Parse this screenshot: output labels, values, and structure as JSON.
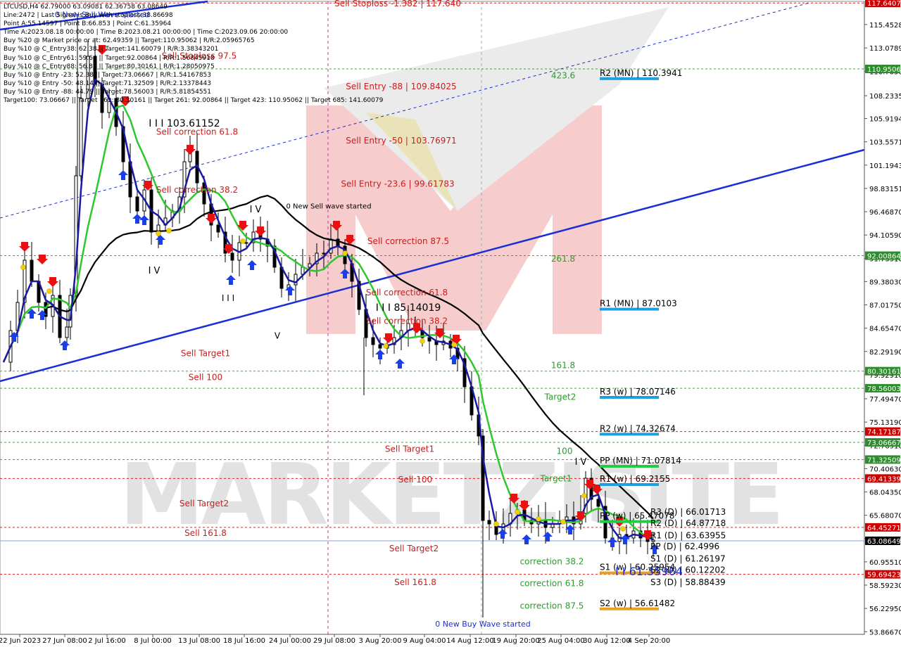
{
  "symbol_header": "LTCUSD,H4  62.79000 63.09081 62.36758 63.08649",
  "info_lines": [
    "Line:2472 | Last Signal is:Buy with stoploss:38.86698",
    "Point A:55.14597 | Point B:66.853 | Point C:61.35964",
    "Time A:2023.08.18 00:00:00 | Time B:2023.08.21 00:00:00 | Time C:2023.09.06 20:00:00",
    "Buy %20 @ Market price or at: 62.49359 || Target:110.95062 | R/R:2.05965765",
    "Buy %10 @ C_Entry38: 62.38 || Target:141.60079 | R/R:3.38343201",
    "Buy %10 @ C_Entry61: 59.64 || Target:92.00864 | R/R:1.56845918",
    "Buy %10 @ C_Entry88: 56.86 || Target:80.30161 | R/R:1.28050975",
    "Buy %10 @ Entry -23: 52.38 || Target:73.06667 | R/R:1.54167853",
    "Buy %10 @ Entry -50: 48.14 || Target:71.32509 | R/R:2.13378443",
    "Buy %10 @ Entry -88: 44.79 || Target:78.56003 | R/R:5.81854551",
    "Target100: 73.06667 || Target 161: 80.30161 || Target 261: 92.00864 || Target 423: 110.95062 || Target 685: 141.60079"
  ],
  "chart_data": {
    "type": "candlestick",
    "y_range": [
      53.6,
      117.8
    ],
    "price_ticks": [
      "115.45280",
      "113.07890",
      "110.70500",
      "108.23350",
      "105.91940",
      "103.55710",
      "101.19430",
      "98.83151",
      "96.46870",
      "94.10590",
      "91.73310",
      "89.38030",
      "87.01750",
      "84.65470",
      "82.29190",
      "79.92910",
      "77.49470",
      "75.13190",
      "72.76910",
      "70.40630",
      "68.04350",
      "65.68070",
      "63.31790",
      "60.95510",
      "58.59230",
      "56.22950",
      "53.86670"
    ],
    "time_labels": [
      "22 Jun 2023",
      "27 Jun 08:00",
      "2 Jul 16:00",
      "8 Jul 00:00",
      "13 Jul 08:00",
      "18 Jul 16:00",
      "24 Jul 00:00",
      "29 Jul 08:00",
      "3 Aug 20:00",
      "9 Aug 04:00",
      "14 Aug 12:00",
      "19 Aug 20:00",
      "25 Aug 04:00",
      "30 Aug 12:00",
      "4 Sep 20:00"
    ],
    "price_boxes": [
      {
        "value": "117.64075",
        "price": 117.64,
        "color": "#cc0000"
      },
      {
        "value": "110.95062",
        "price": 110.95,
        "color": "#2e8b2e"
      },
      {
        "value": "92.00864",
        "price": 92.01,
        "color": "#2e8b2e"
      },
      {
        "value": "80.30161",
        "price": 80.3,
        "color": "#2e8b2e"
      },
      {
        "value": "78.56003",
        "price": 78.56,
        "color": "#2e8b2e"
      },
      {
        "value": "74.17187",
        "price": 74.17,
        "color": "#cc0000"
      },
      {
        "value": "73.06667",
        "price": 73.07,
        "color": "#2e8b2e"
      },
      {
        "value": "71.32509",
        "price": 71.33,
        "color": "#2e8b2e"
      },
      {
        "value": "69.41339",
        "price": 69.41,
        "color": "#cc0000"
      },
      {
        "value": "64.45271",
        "price": 64.45,
        "color": "#cc0000"
      },
      {
        "value": "63.08649",
        "price": 63.09,
        "color": "#000000"
      },
      {
        "value": "59.69423",
        "price": 59.69,
        "color": "#cc0000"
      }
    ],
    "pivots": [
      {
        "label": "R2 (MN) | 110.3941",
        "price": 110.39,
        "color": "#1ea0e0"
      },
      {
        "label": "R1 (MN) | 87.0103",
        "price": 87.01,
        "color": "#1ea0e0"
      },
      {
        "label": "R3 (w) | 78.07146",
        "price": 78.07,
        "color": "#1ea0e0"
      },
      {
        "label": "R2 (w) | 74.32674",
        "price": 74.33,
        "color": "#1ea0e0"
      },
      {
        "label": "PP (MN) | 71.07814",
        "price": 71.08,
        "color": "#22cc44"
      },
      {
        "label": "R1 (w) | 69.2155",
        "price": 69.22,
        "color": "#1ea0e0"
      },
      {
        "label": "PP (w) | 65.47078",
        "price": 65.47,
        "color": "#22cc44"
      },
      {
        "label": "S1 (w) | 60.25954",
        "price": 60.26,
        "color": "#e8a020"
      },
      {
        "label": "S2 (w) | 56.61482",
        "price": 56.61,
        "color": "#e8a020"
      }
    ],
    "daily_pivots": [
      {
        "label": "R3 (D) | 66.01713",
        "price": 66.02
      },
      {
        "label": "R2 (D) | 64.87718",
        "price": 64.88
      },
      {
        "label": "R1 (D) | 63.63955",
        "price": 63.64
      },
      {
        "label": "PP (D) | 62.4996",
        "price": 62.5
      },
      {
        "label": "S1 (D) | 61.26197",
        "price": 61.26
      },
      {
        "label": "S2 (D) | 60.12202",
        "price": 60.12
      },
      {
        "label": "S3 (D) | 58.88439",
        "price": 58.88
      }
    ],
    "red_labels": [
      {
        "text": "Sell Stoploss -1.382 | 117.640",
        "price": 117.3
      },
      {
        "text": "Sell Entry -88 | 109.84025",
        "price": 108.9
      },
      {
        "text": "Sell Entry -50 | 103.76971",
        "price": 103.4
      },
      {
        "text": "Sell Entry -23.6 | 99.61783",
        "price": 99.0
      },
      {
        "text": "Sell correction 87.5",
        "price": 93.2
      },
      {
        "text": "Sell correction 61.8",
        "price": 88.0
      },
      {
        "text": "Sell correction 38.2",
        "price": 85.1
      },
      {
        "text": "Sell correction 61.8",
        "price": 104.3
      },
      {
        "text": "Sell correction 38.2",
        "price": 98.4
      },
      {
        "text": "Sell Target1",
        "price": 81.8
      },
      {
        "text": "Sell 100",
        "price": 79.4
      },
      {
        "text": "Sell Target1",
        "price": 72.1
      },
      {
        "text": "Sell 100",
        "price": 69.0
      },
      {
        "text": "Sell Target2",
        "price": 66.6
      },
      {
        "text": "Sell 161.8",
        "price": 63.6
      },
      {
        "text": "Sell Target2",
        "price": 62.0
      },
      {
        "text": "Sell 161.8",
        "price": 58.6
      },
      {
        "text": "Sell Stoploss 97.5",
        "price": 112.0
      }
    ],
    "green_labels": [
      {
        "text": "423.6",
        "price": 110.0
      },
      {
        "text": "261.8",
        "price": 91.4
      },
      {
        "text": "161.8",
        "price": 80.6
      },
      {
        "text": "Target2",
        "price": 77.4
      },
      {
        "text": "100",
        "price": 71.9
      },
      {
        "text": "Target1",
        "price": 69.1
      },
      {
        "text": "correction 38.2",
        "price": 60.7
      },
      {
        "text": "correction 61.8",
        "price": 58.5
      },
      {
        "text": "correction 87.5",
        "price": 56.2
      }
    ],
    "black_labels": [
      {
        "text": "I I I 103.61152",
        "price": 105.1,
        "size": 14
      },
      {
        "text": "I I I 85.14019",
        "price": 86.4,
        "size": 14
      },
      {
        "text": "I V",
        "price": 96.4,
        "size": 13
      },
      {
        "text": "I V",
        "price": 90.2,
        "size": 13
      },
      {
        "text": "I I I",
        "price": 87.4,
        "size": 12
      },
      {
        "text": "V",
        "price": 83.6,
        "size": 12
      },
      {
        "text": "I V",
        "price": 70.8,
        "size": 13
      },
      {
        "text": "0 New Sell wave started",
        "price": 96.8,
        "size": 10
      }
    ],
    "blue_labels": [
      {
        "text": "0 New Buy Wave started",
        "price": 54.4
      },
      {
        "text": "0 New Sell Wave started",
        "price": 116.2
      },
      {
        "text": "I I 61.35964",
        "price": 59.6
      }
    ],
    "watermark": "MARKETZISITE"
  }
}
